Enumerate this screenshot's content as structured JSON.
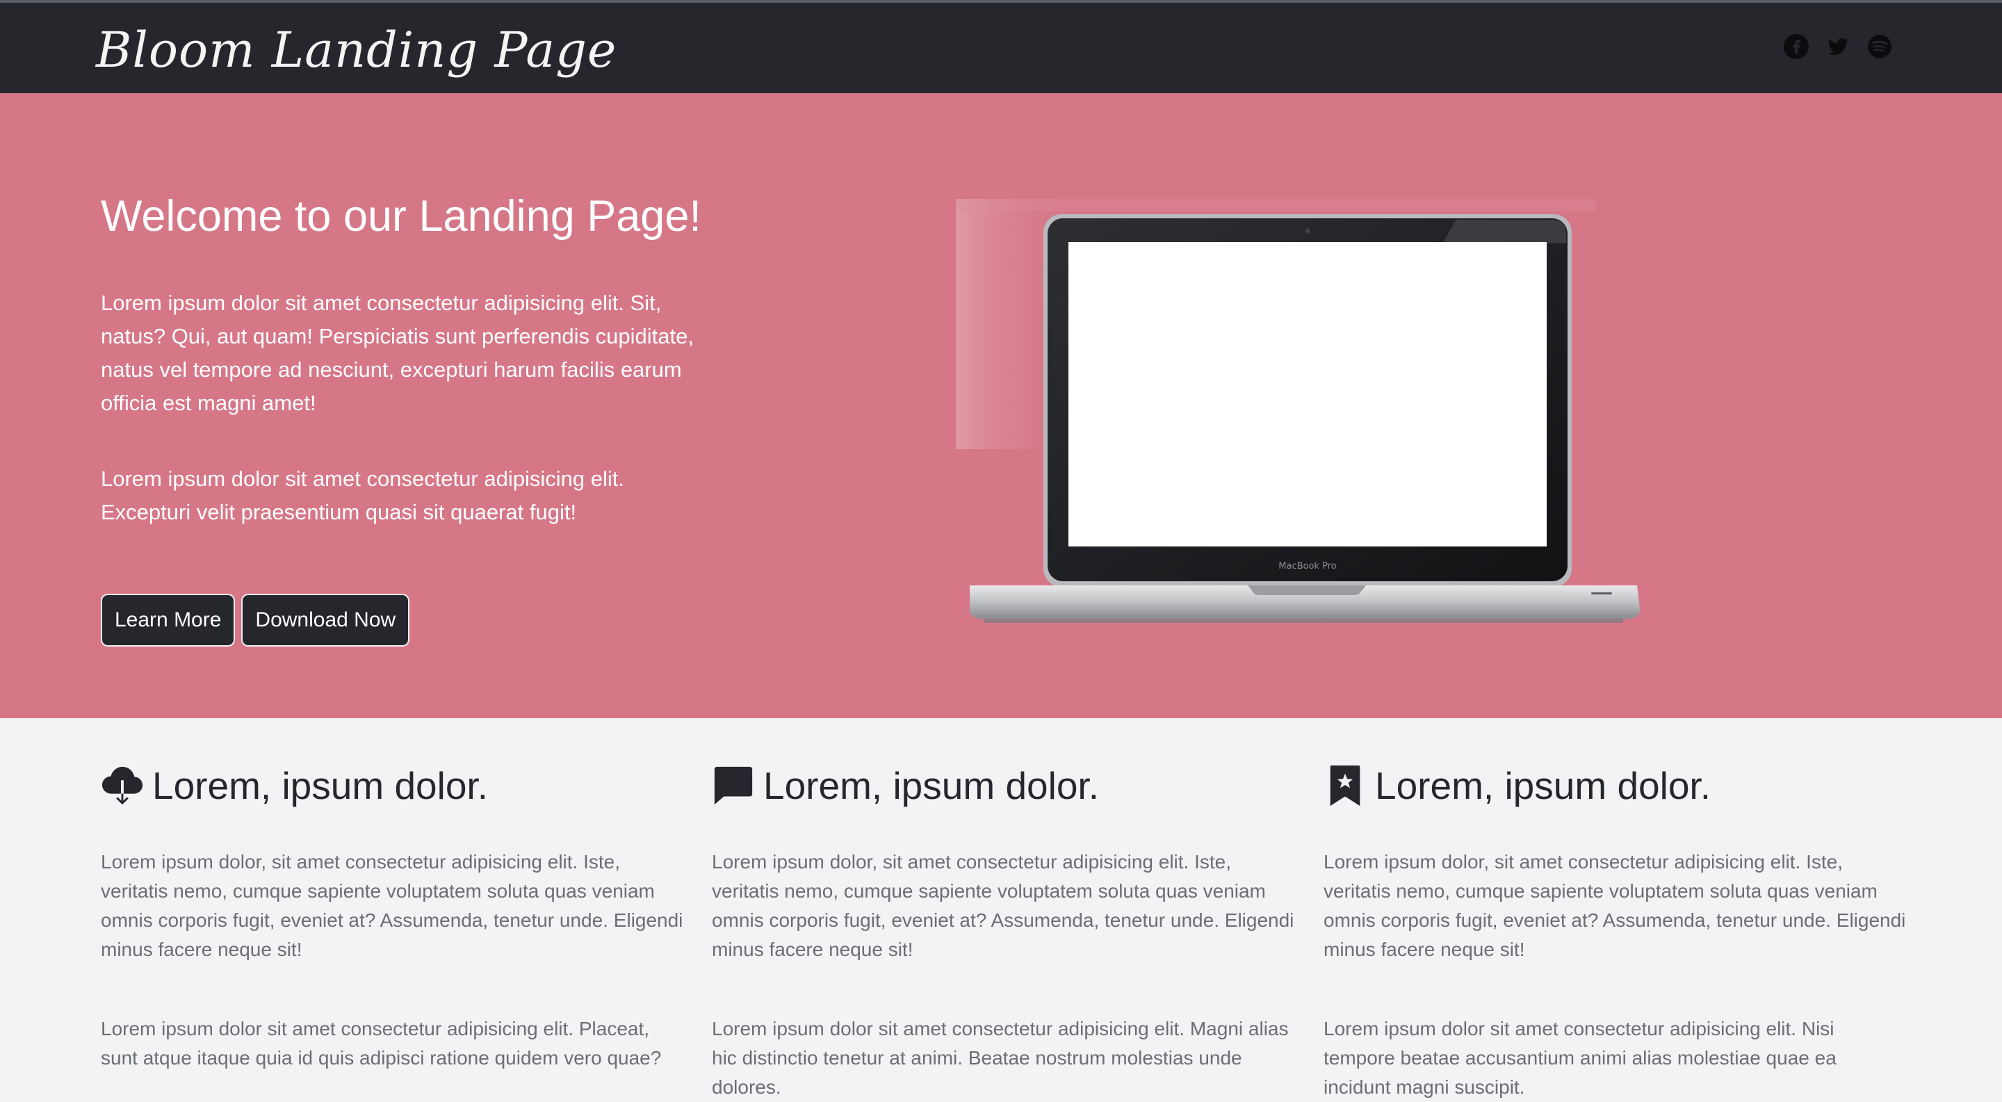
{
  "navbar": {
    "brand": "Bloom Landing Page",
    "social": [
      "facebook-icon",
      "twitter-icon",
      "spotify-icon"
    ]
  },
  "hero": {
    "title": "Welcome to our Landing Page!",
    "paragraph1": "Lorem ipsum dolor sit amet consectetur adipisicing elit. Sit, natus? Qui, aut quam! Perspiciatis sunt perferendis cupiditate, natus vel tempore ad nesciunt, excepturi harum facilis earum officia est magni amet!",
    "paragraph2": "Lorem ipsum dolor sit amet consectetur adipisicing elit. Excepturi velit praesentium quasi sit quaerat fugit!",
    "learn_more_label": "Learn More",
    "download_label": "Download Now",
    "laptop_screen_label": "MacBook Pro"
  },
  "features": [
    {
      "icon": "cloud-download-icon",
      "title": "Lorem, ipsum dolor.",
      "paragraph1": "Lorem ipsum dolor, sit amet consectetur adipisicing elit. Iste, veritatis nemo, cumque sapiente voluptatem soluta quas veniam omnis corporis fugit, eveniet at? Assumenda, tenetur unde. Eligendi minus facere neque sit!",
      "paragraph2": "Lorem ipsum dolor sit amet consectetur adipisicing elit. Placeat, sunt atque itaque quia id quis adipisci ratione quidem vero quae?"
    },
    {
      "icon": "chat-icon",
      "title": "Lorem, ipsum dolor.",
      "paragraph1": "Lorem ipsum dolor, sit amet consectetur adipisicing elit. Iste, veritatis nemo, cumque sapiente voluptatem soluta quas veniam omnis corporis fugit, eveniet at? Assumenda, tenetur unde. Eligendi minus facere neque sit!",
      "paragraph2": "Lorem ipsum dolor sit amet consectetur adipisicing elit. Magni alias hic distinctio tenetur at animi. Beatae nostrum molestias unde dolores."
    },
    {
      "icon": "bookmark-star-icon",
      "title": "Lorem, ipsum dolor.",
      "paragraph1": "Lorem ipsum dolor, sit amet consectetur adipisicing elit. Iste, veritatis nemo, cumque sapiente voluptatem soluta quas veniam omnis corporis fugit, eveniet at? Assumenda, tenetur unde. Eligendi minus facere neque sit!",
      "paragraph2": "Lorem ipsum dolor sit amet consectetur adipisicing elit. Nisi tempore beatae accusantium animi alias molestiae quae ea incidunt magni suscipit."
    }
  ],
  "colors": {
    "navbar_bg": "#25272d",
    "hero_bg": "#d67788",
    "features_bg": "#f3f3f5",
    "button_bg": "#25272d"
  }
}
